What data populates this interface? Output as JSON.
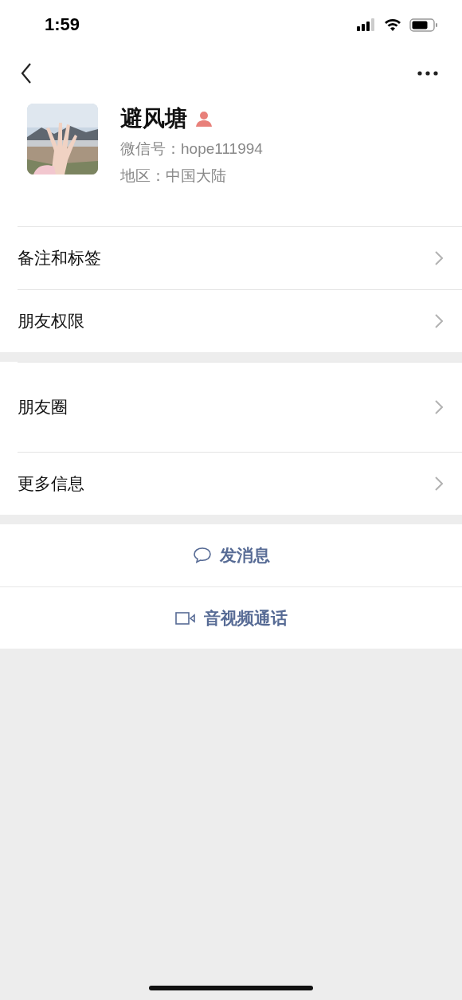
{
  "status_bar": {
    "time": "1:59"
  },
  "profile": {
    "name": "避风塘",
    "wechat_id": "微信号：hope111994",
    "region": "地区：中国大陆"
  },
  "menu_groups": [
    {
      "items": [
        {
          "label": "备注和标签",
          "kind": "plain"
        },
        {
          "label": "朋友权限",
          "kind": "plain"
        }
      ]
    },
    {
      "items": [
        {
          "label": "朋友圈",
          "kind": "tall"
        },
        {
          "label": "更多信息",
          "kind": "plain"
        }
      ]
    }
  ],
  "actions": [
    {
      "label": "发消息",
      "kind": "message"
    },
    {
      "label": "音视频通话",
      "kind": "video"
    }
  ]
}
